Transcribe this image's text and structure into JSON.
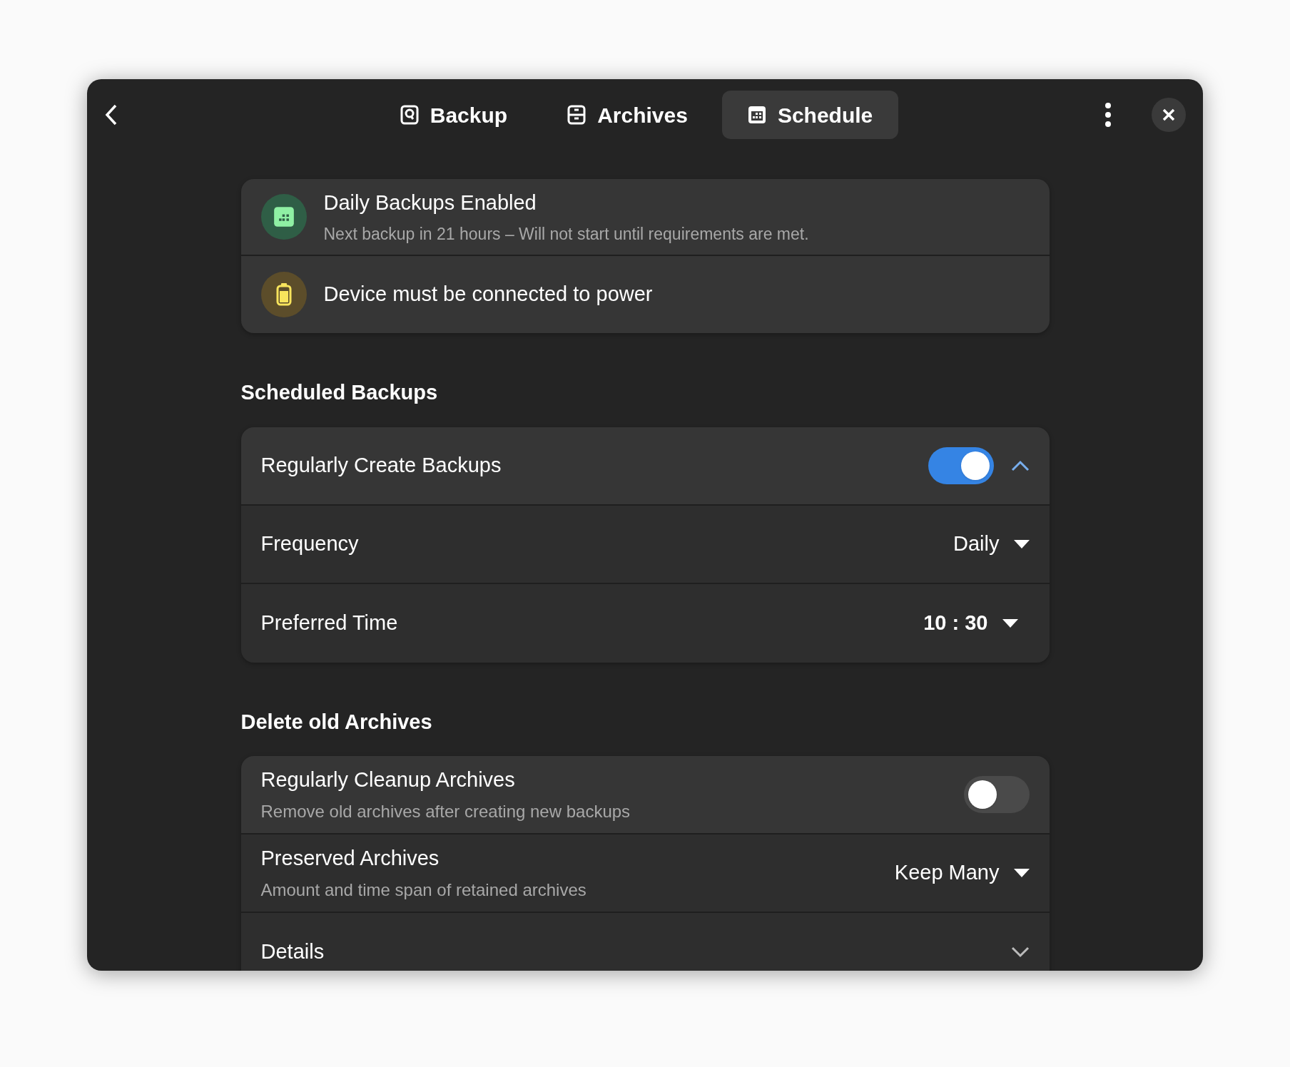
{
  "header": {
    "tabs": [
      {
        "label": "Backup",
        "kind": "backup",
        "selected": false
      },
      {
        "label": "Archives",
        "kind": "archives",
        "selected": false
      },
      {
        "label": "Schedule",
        "kind": "schedule",
        "selected": true
      }
    ]
  },
  "status": [
    {
      "kind": "schedule",
      "title": "Daily Backups Enabled",
      "subtitle": "Next backup in 21 hours – Will not start until requirements are met."
    },
    {
      "kind": "power",
      "title": "Device must be connected to power"
    }
  ],
  "sections": [
    {
      "title": "Scheduled Backups",
      "rows": [
        {
          "kind": "switch",
          "label": "Regularly Create Backups",
          "on": true,
          "expanded": true
        },
        {
          "kind": "dropdown",
          "label": "Frequency",
          "value": "Daily"
        },
        {
          "kind": "time",
          "label": "Preferred Time",
          "value": "10 : 30"
        }
      ]
    },
    {
      "title": "Delete old Archives",
      "rows": [
        {
          "kind": "switch",
          "label": "Regularly Cleanup Archives",
          "subtitle": "Remove old archives after creating new backups",
          "on": false
        },
        {
          "kind": "dropdown",
          "label": "Preserved Archives",
          "subtitle": "Amount and time span of retained archives",
          "value": "Keep Many"
        },
        {
          "kind": "expander",
          "label": "Details",
          "expanded": false
        }
      ]
    }
  ]
}
